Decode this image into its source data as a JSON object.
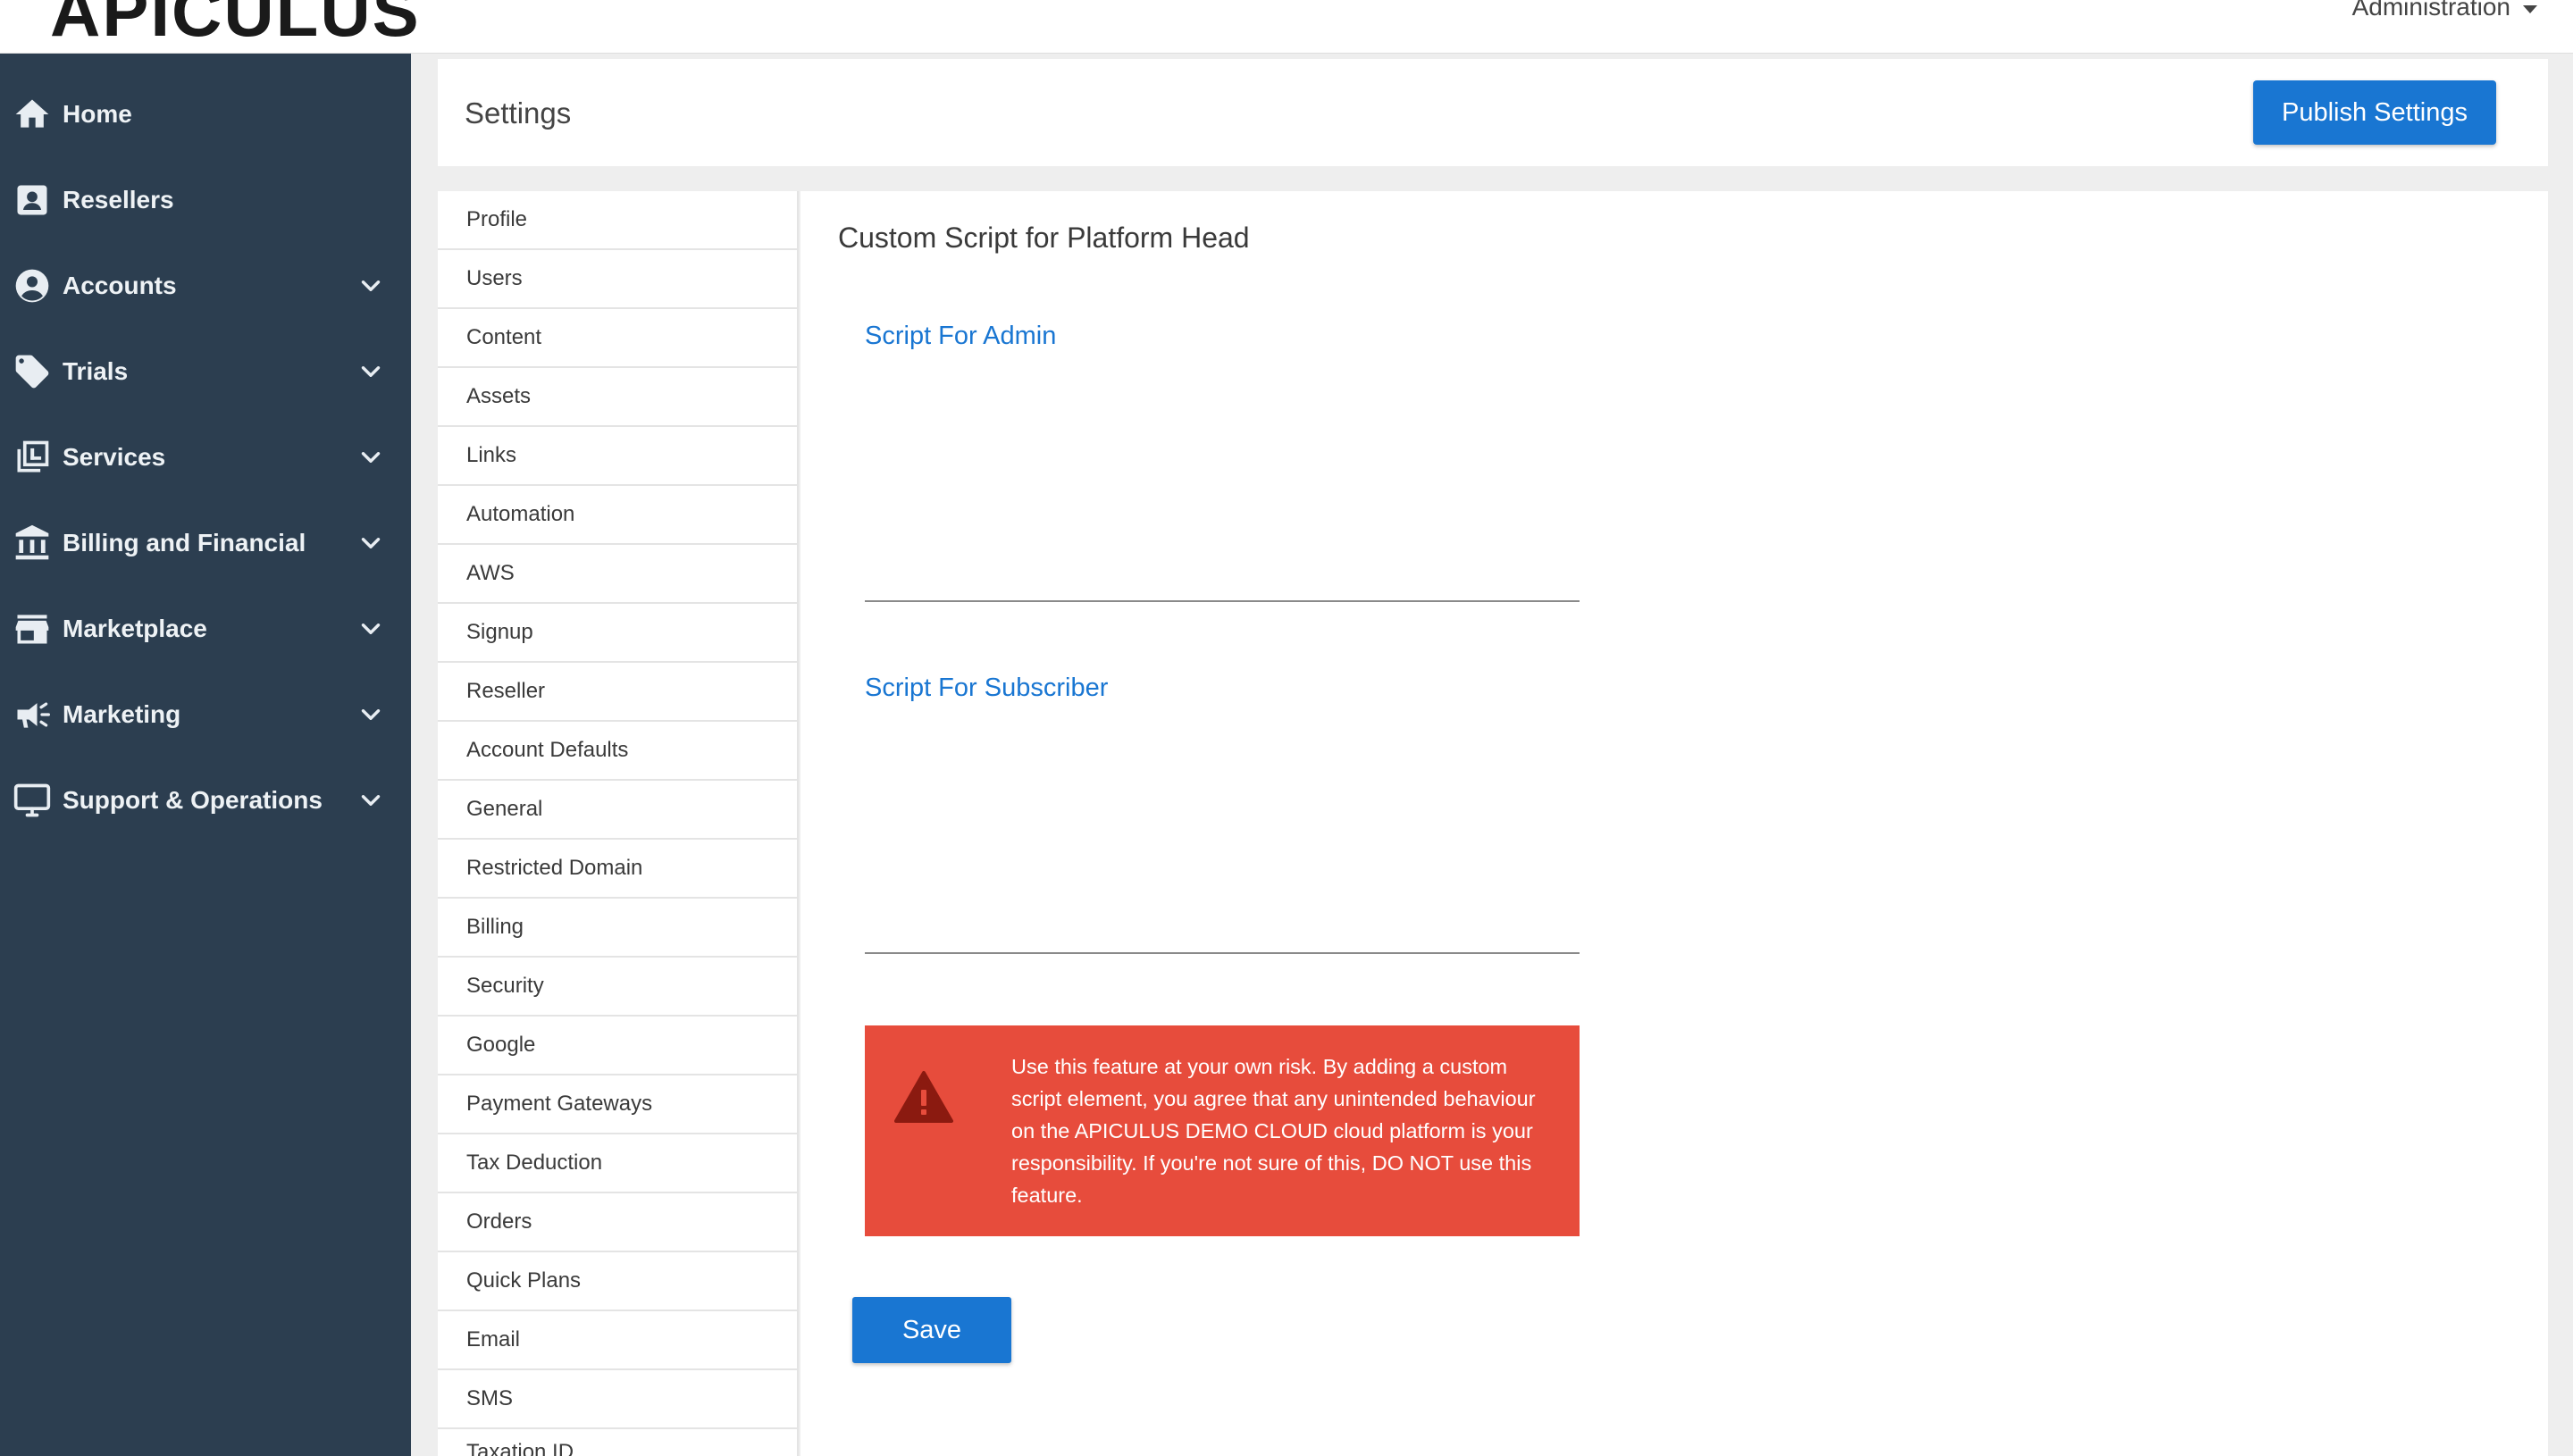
{
  "app": {
    "logo_text": "APICULUS",
    "admin_menu_label": "Administration"
  },
  "sidebar": {
    "items": [
      {
        "label": "Home",
        "icon": "home-icon",
        "has_chevron": false
      },
      {
        "label": "Resellers",
        "icon": "contact-card-icon",
        "has_chevron": false
      },
      {
        "label": "Accounts",
        "icon": "account-circle-icon",
        "has_chevron": true
      },
      {
        "label": "Trials",
        "icon": "tag-icon",
        "has_chevron": true
      },
      {
        "label": "Services",
        "icon": "library-icon",
        "has_chevron": true
      },
      {
        "label": "Billing and Financial",
        "icon": "bank-icon",
        "has_chevron": true
      },
      {
        "label": "Marketplace",
        "icon": "store-icon",
        "has_chevron": true
      },
      {
        "label": "Marketing",
        "icon": "megaphone-icon",
        "has_chevron": true
      },
      {
        "label": "Support & Operations",
        "icon": "monitor-icon",
        "has_chevron": true
      }
    ]
  },
  "header": {
    "title": "Settings",
    "publish_label": "Publish Settings"
  },
  "settings_nav": {
    "items": [
      "Profile",
      "Users",
      "Content",
      "Assets",
      "Links",
      "Automation",
      "AWS",
      "Signup",
      "Reseller",
      "Account Defaults",
      "General",
      "Restricted Domain",
      "Billing",
      "Security",
      "Google",
      "Payment Gateways",
      "Tax Deduction",
      "Orders",
      "Quick Plans",
      "Email",
      "SMS",
      "Taxation ID"
    ]
  },
  "content": {
    "section_title": "Custom Script for Platform Head",
    "admin_label": "Script For Admin",
    "admin_value": "",
    "subscriber_label": "Script For Subscriber",
    "subscriber_value": "",
    "warning_text": "Use this feature at your own risk. By adding a custom script element, you agree that any unintended behaviour on the APICULUS DEMO CLOUD cloud platform is your responsibility. If you're not sure of this, DO NOT use this feature.",
    "save_label": "Save"
  },
  "colors": {
    "sidebar_bg": "#2c3e50",
    "primary": "#1976d2",
    "warning": "#e74c3c",
    "warning_icon": "#8b1a10"
  }
}
